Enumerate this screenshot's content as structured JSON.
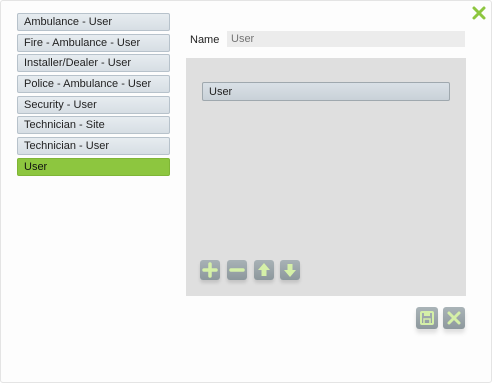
{
  "dialog": {
    "close_icon": "close-x-icon",
    "accent_color": "#8dc63f"
  },
  "list": {
    "items": [
      {
        "label": "Ambulance - User"
      },
      {
        "label": "Fire - Ambulance - User"
      },
      {
        "label": "Installer/Dealer - User"
      },
      {
        "label": "Police - Ambulance - User"
      },
      {
        "label": "Security - User"
      },
      {
        "label": "Technician - Site"
      },
      {
        "label": "Technician - User"
      },
      {
        "label": "User",
        "selected": true
      }
    ]
  },
  "form": {
    "name_label": "Name",
    "name_placeholder": "User",
    "name_value": ""
  },
  "panel": {
    "items": [
      {
        "label": "User"
      }
    ],
    "toolbar": {
      "add_icon": "plus-icon",
      "remove_icon": "minus-icon",
      "move_up_icon": "arrow-up-icon",
      "move_down_icon": "arrow-down-icon"
    }
  },
  "footer": {
    "save_icon": "save-icon",
    "cancel_icon": "cancel-icon"
  }
}
